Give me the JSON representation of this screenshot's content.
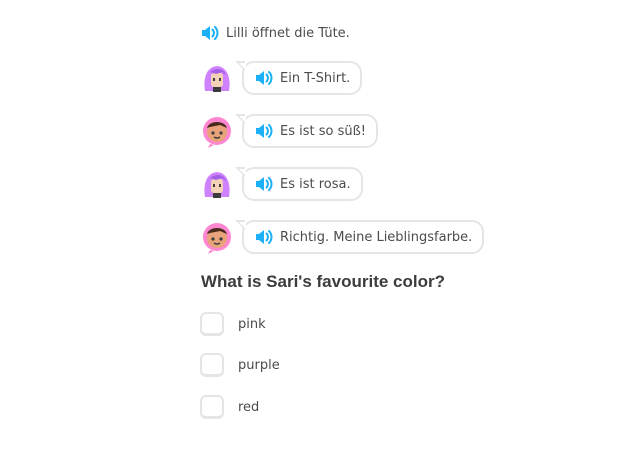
{
  "narration": {
    "text": "Lilli öffnet die Tüte.",
    "icon": "speaker-icon"
  },
  "dialogue": [
    {
      "speaker": "lilli",
      "text": "Ein T-Shirt."
    },
    {
      "speaker": "sari",
      "text": "Es ist so süß!"
    },
    {
      "speaker": "lilli",
      "text": "Es ist rosa."
    },
    {
      "speaker": "sari",
      "text": "Richtig. Meine Lieblingsfarbe."
    }
  ],
  "question": "What is Sari's favourite color?",
  "options": [
    {
      "label": "pink"
    },
    {
      "label": "purple"
    },
    {
      "label": "red"
    }
  ],
  "colors": {
    "speaker_blue": "#1cb0f6",
    "border": "#e5e5e5",
    "lilli_purple": "#ce82ff",
    "sari_pink": "#ff86d0"
  }
}
